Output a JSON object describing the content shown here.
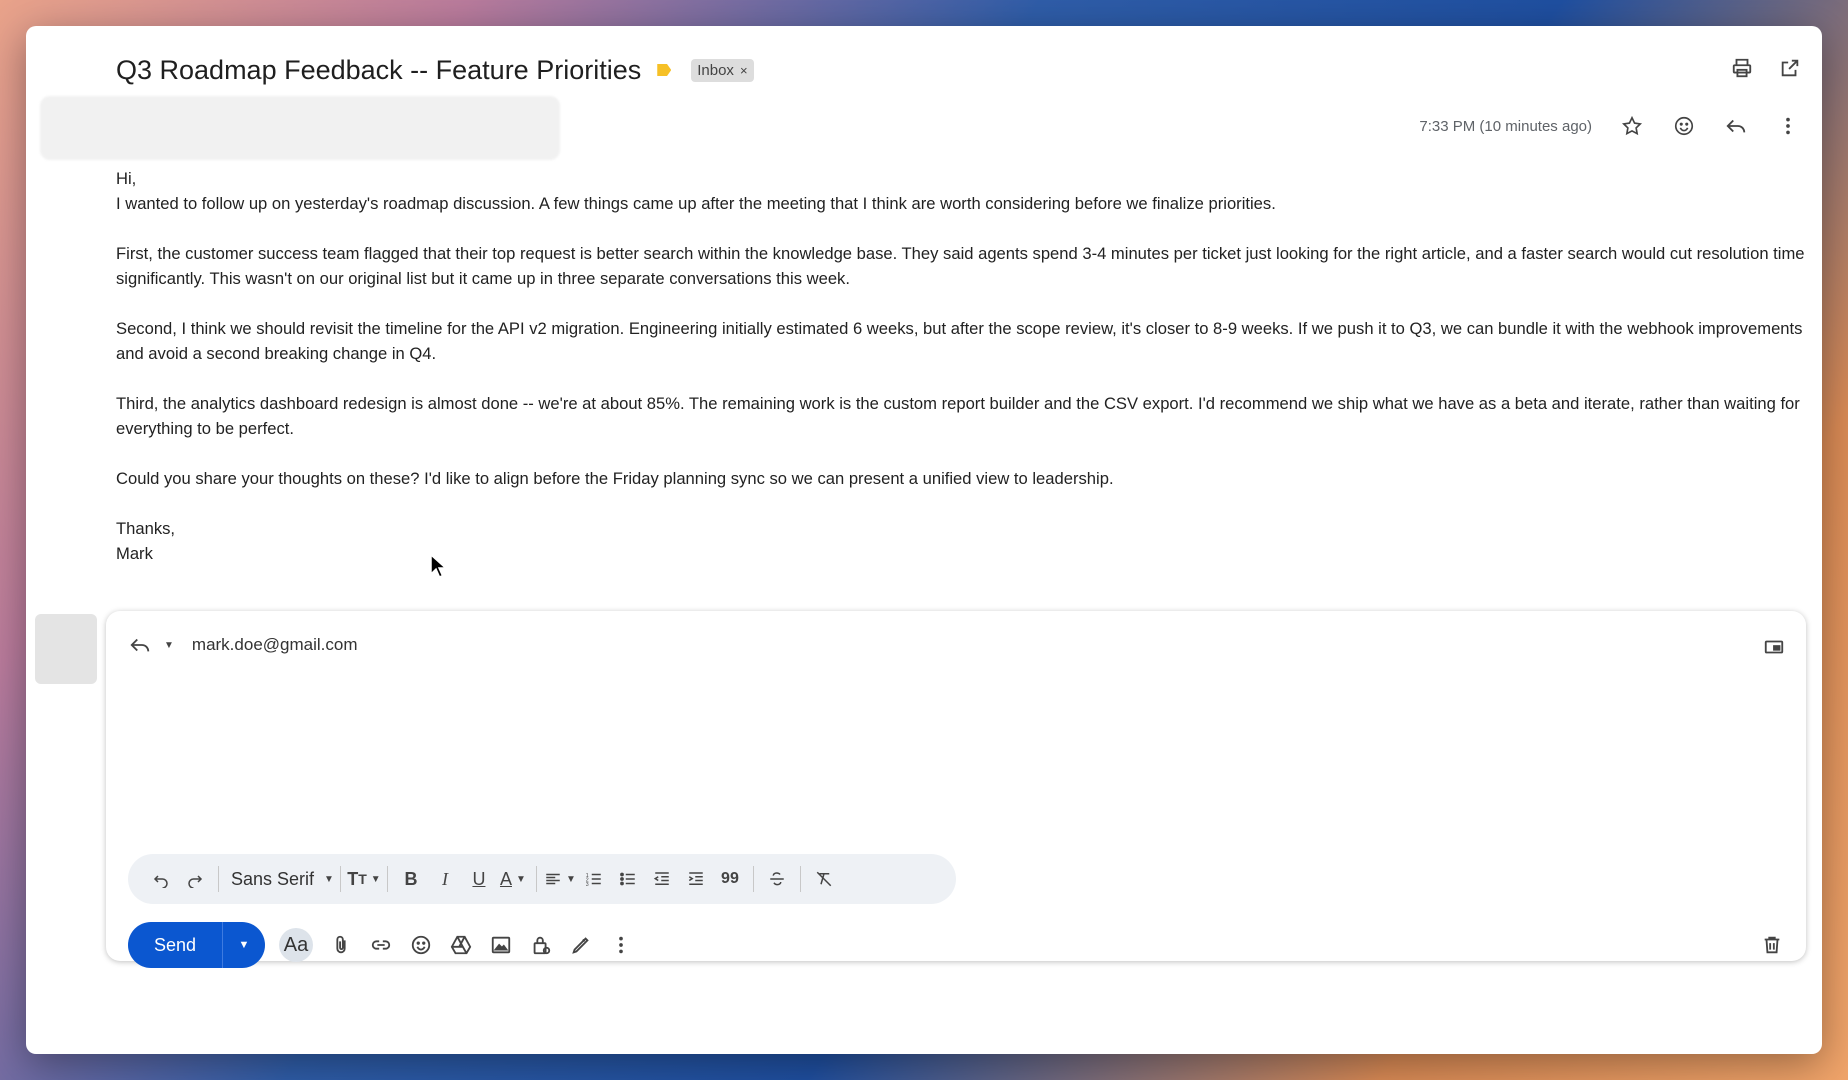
{
  "email": {
    "subject": "Q3 Roadmap Feedback -- Feature Priorities",
    "label": "Inbox",
    "label_remove": "×",
    "timestamp": "7:33 PM (10 minutes ago)",
    "greeting": "Hi,",
    "paragraphs": [
      "I wanted to follow up on yesterday's roadmap discussion. A few things came up after the meeting that I think are worth considering before we finalize priorities.",
      "First, the customer success team flagged that their top request is better search within the knowledge base. They said agents spend 3-4 minutes per ticket just looking for the right article, and a faster search would cut resolution time significantly. This wasn't on our original list but it came up in three separate conversations this week.",
      "Second, I think we should revisit the timeline for the API v2 migration. Engineering initially estimated 6 weeks, but after the scope review, it's closer to 8-9 weeks. If we push it to Q3, we can bundle it with the webhook improvements and avoid a second breaking change in Q4.",
      "Third, the analytics dashboard redesign is almost done -- we're at about 85%. The remaining work is the custom report builder and the CSV export. I'd recommend we ship what we have as a beta and iterate, rather than waiting for everything to be perfect.",
      "Could you share your thoughts on these? I'd like to align before the Friday planning sync so we can present a unified view to leadership."
    ],
    "signoff": "Thanks,",
    "signature": "Mark"
  },
  "reply": {
    "recipient": "mark.doe@gmail.com",
    "font": "Sans Serif",
    "send_label": "Send",
    "aa_label": "Aa"
  },
  "colors": {
    "primary": "#0b57d0",
    "important_marker": "#f6c026"
  }
}
